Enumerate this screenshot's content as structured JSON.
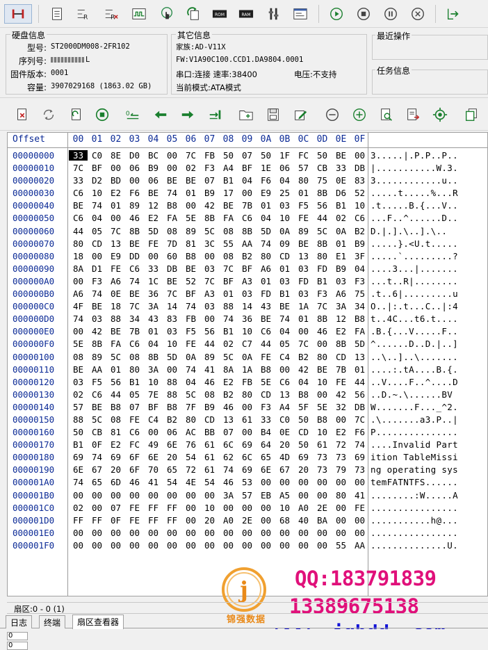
{
  "toolbar_top": {
    "icons": [
      "hdd-connect-icon",
      "sector-doc-icon",
      "read-r-icon",
      "write-r-icon",
      "signal-wave-icon",
      "touch-icon",
      "refresh-copy-icon",
      "rom-chip-icon",
      "ram-chip-icon",
      "tools-icon",
      "terminal-icon",
      "play-icon",
      "stop-icon",
      "pause-icon",
      "cancel-icon",
      "exit-icon"
    ],
    "rom_label": "ROM",
    "ram_label": "RAM"
  },
  "disk_info": {
    "title": "硬盘信息",
    "model_label": "型号:",
    "model_value": "ST2000DM008-2FR102",
    "serial_label": "序列号:",
    "serial_value": "L",
    "firmware_label": "固件版本:",
    "firmware_value": "0001",
    "capacity_label": "容量:",
    "capacity_value": "3907029168 (1863.02 GB)"
  },
  "other_info": {
    "title": "其它信息",
    "family": "家族:AD-V11X",
    "fw": "FW:V1A90C100.CCD1.DA9804.0001",
    "port": "串口:连接 速率:38400",
    "voltage": "电压:不支持",
    "mode": "当前模式:ATA模式"
  },
  "recent_ops": {
    "title": "最近操作"
  },
  "task_info": {
    "title": "任务信息"
  },
  "toolbar_second": {
    "icons": [
      "clear-icon",
      "sync-icon",
      "reload-icon",
      "stop-circle-icon",
      "goto-start-icon",
      "arrow-left-icon",
      "arrow-right-icon",
      "goto-end-icon",
      "open-folder-icon",
      "save-icon",
      "edit-icon",
      "zoom-out-icon",
      "zoom-in-icon",
      "search-icon",
      "export-icon",
      "target-icon",
      "copy-icon"
    ]
  },
  "hex": {
    "offset_header": "Offset",
    "columns": [
      "00",
      "01",
      "02",
      "03",
      "04",
      "05",
      "06",
      "07",
      "08",
      "09",
      "0A",
      "0B",
      "0C",
      "0D",
      "0E",
      "0F"
    ],
    "rows": [
      {
        "offset": "00000000",
        "bytes": [
          "33",
          "C0",
          "8E",
          "D0",
          "BC",
          "00",
          "7C",
          "FB",
          "50",
          "07",
          "50",
          "1F",
          "FC",
          "50",
          "BE",
          "00"
        ],
        "ascii": "3.....|.P.P..P.."
      },
      {
        "offset": "00000010",
        "bytes": [
          "7C",
          "BF",
          "00",
          "06",
          "B9",
          "00",
          "02",
          "F3",
          "A4",
          "BF",
          "1E",
          "06",
          "57",
          "CB",
          "33",
          "DB"
        ],
        "ascii": "|...........W.3."
      },
      {
        "offset": "00000020",
        "bytes": [
          "33",
          "D2",
          "BD",
          "00",
          "06",
          "BE",
          "BE",
          "07",
          "B1",
          "04",
          "F6",
          "04",
          "80",
          "75",
          "0E",
          "83"
        ],
        "ascii": "3............u.."
      },
      {
        "offset": "00000030",
        "bytes": [
          "C6",
          "10",
          "E2",
          "F6",
          "BE",
          "74",
          "01",
          "B9",
          "17",
          "00",
          "E9",
          "25",
          "01",
          "8B",
          "D6",
          "52"
        ],
        "ascii": ".....t.....%...R"
      },
      {
        "offset": "00000040",
        "bytes": [
          "BE",
          "74",
          "01",
          "89",
          "12",
          "B8",
          "00",
          "42",
          "BE",
          "7B",
          "01",
          "03",
          "F5",
          "56",
          "B1",
          "10"
        ],
        "ascii": ".t.....B.{...V.."
      },
      {
        "offset": "00000050",
        "bytes": [
          "C6",
          "04",
          "00",
          "46",
          "E2",
          "FA",
          "5E",
          "8B",
          "FA",
          "C6",
          "04",
          "10",
          "FE",
          "44",
          "02",
          "C6"
        ],
        "ascii": "...F..^......D.."
      },
      {
        "offset": "00000060",
        "bytes": [
          "44",
          "05",
          "7C",
          "8B",
          "5D",
          "08",
          "89",
          "5C",
          "08",
          "8B",
          "5D",
          "0A",
          "89",
          "5C",
          "0A",
          "B2"
        ],
        "ascii": "D.|.].\\..].\\.."
      },
      {
        "offset": "00000070",
        "bytes": [
          "80",
          "CD",
          "13",
          "BE",
          "FE",
          "7D",
          "81",
          "3C",
          "55",
          "AA",
          "74",
          "09",
          "BE",
          "8B",
          "01",
          "B9"
        ],
        "ascii": ".....}.<U.t....."
      },
      {
        "offset": "00000080",
        "bytes": [
          "18",
          "00",
          "E9",
          "DD",
          "00",
          "60",
          "B8",
          "00",
          "08",
          "B2",
          "80",
          "CD",
          "13",
          "80",
          "E1",
          "3F"
        ],
        "ascii": ".....`.........?"
      },
      {
        "offset": "00000090",
        "bytes": [
          "8A",
          "D1",
          "FE",
          "C6",
          "33",
          "DB",
          "BE",
          "03",
          "7C",
          "BF",
          "A6",
          "01",
          "03",
          "FD",
          "B9",
          "04"
        ],
        "ascii": "....3...|......."
      },
      {
        "offset": "000000A0",
        "bytes": [
          "00",
          "F3",
          "A6",
          "74",
          "1C",
          "BE",
          "52",
          "7C",
          "BF",
          "A3",
          "01",
          "03",
          "FD",
          "B1",
          "03",
          "F3"
        ],
        "ascii": "...t..R|........"
      },
      {
        "offset": "000000B0",
        "bytes": [
          "A6",
          "74",
          "0E",
          "BE",
          "36",
          "7C",
          "BF",
          "A3",
          "01",
          "03",
          "FD",
          "B1",
          "03",
          "F3",
          "A6",
          "75"
        ],
        "ascii": ".t..6|.........u"
      },
      {
        "offset": "000000C0",
        "bytes": [
          "4F",
          "BE",
          "18",
          "7C",
          "3A",
          "14",
          "74",
          "03",
          "88",
          "14",
          "43",
          "BE",
          "1A",
          "7C",
          "3A",
          "34"
        ],
        "ascii": "O..|:.t...C..|:4"
      },
      {
        "offset": "000000D0",
        "bytes": [
          "74",
          "03",
          "88",
          "34",
          "43",
          "83",
          "FB",
          "00",
          "74",
          "36",
          "BE",
          "74",
          "01",
          "8B",
          "12",
          "B8"
        ],
        "ascii": "t..4C...t6.t...."
      },
      {
        "offset": "000000E0",
        "bytes": [
          "00",
          "42",
          "BE",
          "7B",
          "01",
          "03",
          "F5",
          "56",
          "B1",
          "10",
          "C6",
          "04",
          "00",
          "46",
          "E2",
          "FA"
        ],
        "ascii": ".B.{...V.....F.."
      },
      {
        "offset": "000000F0",
        "bytes": [
          "5E",
          "8B",
          "FA",
          "C6",
          "04",
          "10",
          "FE",
          "44",
          "02",
          "C7",
          "44",
          "05",
          "7C",
          "00",
          "8B",
          "5D"
        ],
        "ascii": "^......D..D.|..]"
      },
      {
        "offset": "00000100",
        "bytes": [
          "08",
          "89",
          "5C",
          "08",
          "8B",
          "5D",
          "0A",
          "89",
          "5C",
          "0A",
          "FE",
          "C4",
          "B2",
          "80",
          "CD",
          "13"
        ],
        "ascii": "..\\..]..\\......."
      },
      {
        "offset": "00000110",
        "bytes": [
          "BE",
          "AA",
          "01",
          "80",
          "3A",
          "00",
          "74",
          "41",
          "8A",
          "1A",
          "B8",
          "00",
          "42",
          "BE",
          "7B",
          "01"
        ],
        "ascii": "....:.tA....B.{."
      },
      {
        "offset": "00000120",
        "bytes": [
          "03",
          "F5",
          "56",
          "B1",
          "10",
          "88",
          "04",
          "46",
          "E2",
          "FB",
          "5E",
          "C6",
          "04",
          "10",
          "FE",
          "44"
        ],
        "ascii": "..V....F..^....D"
      },
      {
        "offset": "00000130",
        "bytes": [
          "02",
          "C6",
          "44",
          "05",
          "7E",
          "88",
          "5C",
          "08",
          "B2",
          "80",
          "CD",
          "13",
          "B8",
          "00",
          "42",
          "56"
        ],
        "ascii": "..D.~.\\......BV"
      },
      {
        "offset": "00000140",
        "bytes": [
          "57",
          "BE",
          "B8",
          "07",
          "BF",
          "B8",
          "7F",
          "B9",
          "46",
          "00",
          "F3",
          "A4",
          "5F",
          "5E",
          "32",
          "DB"
        ],
        "ascii": "W.......F..._^2."
      },
      {
        "offset": "00000150",
        "bytes": [
          "88",
          "5C",
          "08",
          "FE",
          "C4",
          "B2",
          "80",
          "CD",
          "13",
          "61",
          "33",
          "C0",
          "50",
          "B8",
          "00",
          "7C"
        ],
        "ascii": ".\\.......a3.P..|"
      },
      {
        "offset": "00000160",
        "bytes": [
          "50",
          "CB",
          "81",
          "C6",
          "00",
          "06",
          "AC",
          "BB",
          "07",
          "00",
          "B4",
          "0E",
          "CD",
          "10",
          "E2",
          "F6"
        ],
        "ascii": "P..............."
      },
      {
        "offset": "00000170",
        "bytes": [
          "B1",
          "0F",
          "E2",
          "FC",
          "49",
          "6E",
          "76",
          "61",
          "6C",
          "69",
          "64",
          "20",
          "50",
          "61",
          "72",
          "74"
        ],
        "ascii": "....Invalid Part"
      },
      {
        "offset": "00000180",
        "bytes": [
          "69",
          "74",
          "69",
          "6F",
          "6E",
          "20",
          "54",
          "61",
          "62",
          "6C",
          "65",
          "4D",
          "69",
          "73",
          "73",
          "69"
        ],
        "ascii": "ition TableMissi"
      },
      {
        "offset": "00000190",
        "bytes": [
          "6E",
          "67",
          "20",
          "6F",
          "70",
          "65",
          "72",
          "61",
          "74",
          "69",
          "6E",
          "67",
          "20",
          "73",
          "79",
          "73"
        ],
        "ascii": "ng operating sys"
      },
      {
        "offset": "000001A0",
        "bytes": [
          "74",
          "65",
          "6D",
          "46",
          "41",
          "54",
          "4E",
          "54",
          "46",
          "53",
          "00",
          "00",
          "00",
          "00",
          "00",
          "00"
        ],
        "ascii": "temFATNTFS......"
      },
      {
        "offset": "000001B0",
        "bytes": [
          "00",
          "00",
          "00",
          "00",
          "00",
          "00",
          "00",
          "00",
          "3A",
          "57",
          "EB",
          "A5",
          "00",
          "00",
          "80",
          "41"
        ],
        "ascii": "........:W.....A"
      },
      {
        "offset": "000001C0",
        "bytes": [
          "02",
          "00",
          "07",
          "FE",
          "FF",
          "FF",
          "00",
          "10",
          "00",
          "00",
          "00",
          "10",
          "A0",
          "2E",
          "00",
          "FE"
        ],
        "ascii": "................"
      },
      {
        "offset": "000001D0",
        "bytes": [
          "FF",
          "FF",
          "0F",
          "FE",
          "FF",
          "FF",
          "00",
          "20",
          "A0",
          "2E",
          "00",
          "68",
          "40",
          "BA",
          "00",
          "00"
        ],
        "ascii": "...........h@..."
      },
      {
        "offset": "000001E0",
        "bytes": [
          "00",
          "00",
          "00",
          "00",
          "00",
          "00",
          "00",
          "00",
          "00",
          "00",
          "00",
          "00",
          "00",
          "00",
          "00",
          "00"
        ],
        "ascii": "................"
      },
      {
        "offset": "000001F0",
        "bytes": [
          "00",
          "00",
          "00",
          "00",
          "00",
          "00",
          "00",
          "00",
          "00",
          "00",
          "00",
          "00",
          "00",
          "00",
          "55",
          "AA"
        ],
        "ascii": "..............U."
      }
    ]
  },
  "status": {
    "sector": "扇区:0 - 0 (1)"
  },
  "tabs": [
    {
      "label": "日志"
    },
    {
      "label": "终端"
    },
    {
      "label": "扇区查看器",
      "active": true
    }
  ],
  "lower_pane": {
    "field1": "0",
    "field2": "0"
  },
  "watermark": {
    "logo_letter": "j",
    "brand": "锦强数据",
    "qq": "QQ:183791839",
    "phone": "13389675138",
    "url": "www. jqhdd. com"
  },
  "colors": {
    "offset_blue": "#0b2a96",
    "watermark_pink": "#e0107a",
    "watermark_blue": "#1414d8",
    "logo_orange": "#e98a1a"
  }
}
